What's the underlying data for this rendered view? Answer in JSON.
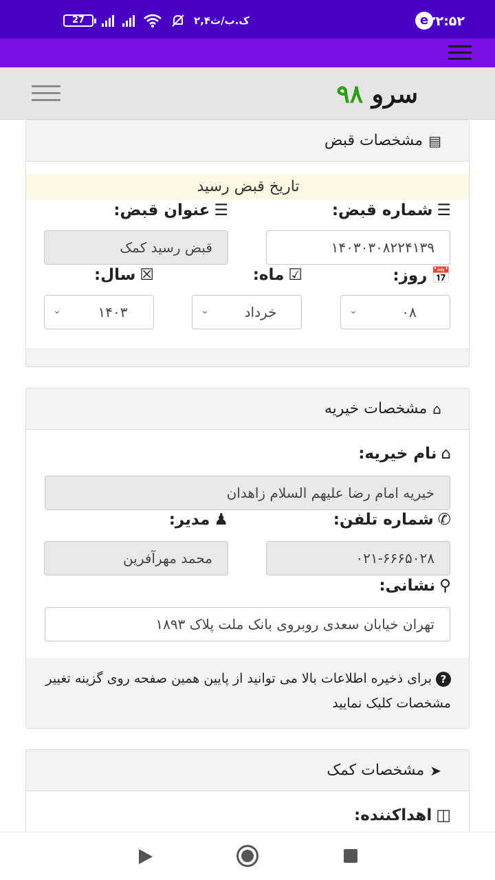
{
  "status_bar": {
    "time": "۲۲:۵۲",
    "speed": "۲,۴ک.ب/ث",
    "battery": "27"
  },
  "site": {
    "logo_word": "سرو",
    "logo_number": "۹۸"
  },
  "receipt_card": {
    "title": "مشخصات قبض",
    "banner": "تاریخ قبض رسید",
    "receipt_number_label": "شماره قبض:",
    "receipt_number_value": "۱۴۰۳۰۳۰۸۲۲۴۱۳۹",
    "receipt_title_label": "عنوان قبض:",
    "receipt_title_value": "قبض رسید کمک",
    "day_label": "روز:",
    "day_value": "۰۸",
    "month_label": "ماه:",
    "month_value": "خرداد",
    "year_label": "سال:",
    "year_value": "۱۴۰۳"
  },
  "charity_card": {
    "title": "مشخصات خیریه",
    "name_label": "نام خیریه:",
    "name_value": "خیریه امام رضا علیهم السلام زاهدان",
    "phone_label": "شماره تلفن:",
    "phone_value": "۰۲۱-۶۶۶۵۰۲۸",
    "manager_label": "مدیر:",
    "manager_value": "محمد مهرآفرین",
    "address_label": "نشانی:",
    "address_value": "تهران خیابان سعدی روبروی بانک ملت پلاک ۱۸۹۳",
    "help_text": "برای ذخیره اطلاعات بالا می توانید از پایین همین صفحه روی گزینه تغییر مشخصات کلیک نمایید"
  },
  "aid_card": {
    "title": "مشخصات کمک",
    "donor_label": "اهداکننده:"
  },
  "icons": {
    "accent_purple": "#7a10e6",
    "status_purple": "#4a00c4",
    "logo_green": "#2e9d16"
  }
}
